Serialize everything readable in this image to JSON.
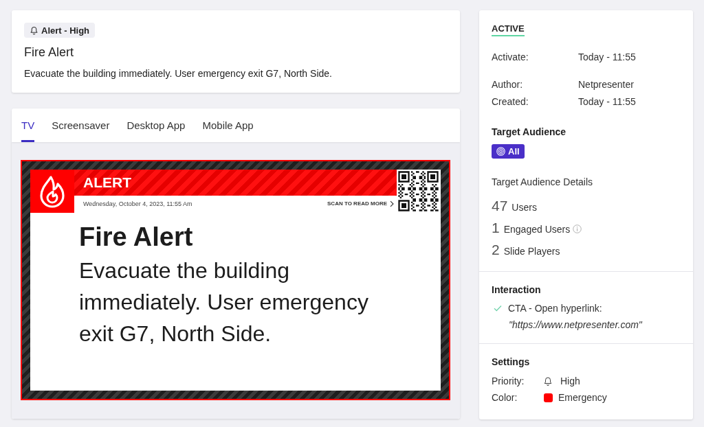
{
  "alert_summary": {
    "badge": {
      "label": "Alert - High"
    },
    "title": "Fire Alert",
    "message": "Evacuate the building immediately. User emergency exit G7, North Side."
  },
  "tabs": [
    {
      "label": "TV",
      "selected": true
    },
    {
      "label": "Screensaver",
      "selected": false
    },
    {
      "label": "Desktop App",
      "selected": false
    },
    {
      "label": "Mobile App",
      "selected": false
    }
  ],
  "preview": {
    "header": "ALERT",
    "timestamp": "Wednesday, October 4, 2023, 11:55 Am",
    "scan_prompt": "SCAN TO READ MORE",
    "title": "Fire Alert",
    "message": "Evacuate the building immediately. User emergency exit G7, North Side."
  },
  "details": {
    "status": "ACTIVE",
    "schedule": [
      {
        "label": "Activate:",
        "value": "Today - 11:55"
      }
    ],
    "meta": [
      {
        "label": "Author:",
        "value": "Netpresenter"
      },
      {
        "label": "Created:",
        "value": "Today - 11:55"
      }
    ],
    "target_audience": {
      "heading": "Target Audience",
      "badge": "All"
    },
    "audience_details": {
      "heading": "Target Audience Details",
      "stats": [
        {
          "count": "47",
          "label": "Users",
          "info": false
        },
        {
          "count": "1",
          "label": "Engaged Users",
          "info": true
        },
        {
          "count": "2",
          "label": "Slide Players",
          "info": false
        }
      ]
    },
    "interaction": {
      "heading": "Interaction",
      "items": [
        {
          "label": "CTA - Open hyperlink:",
          "url": "\"https://www.netpresenter.com\"",
          "checked": true
        }
      ]
    },
    "settings": {
      "heading": "Settings",
      "rows": [
        {
          "kind": "priority",
          "label": "Priority:",
          "value": "High"
        },
        {
          "kind": "color",
          "label": "Color:",
          "value": "Emergency",
          "color": "#ff0000"
        }
      ]
    }
  }
}
